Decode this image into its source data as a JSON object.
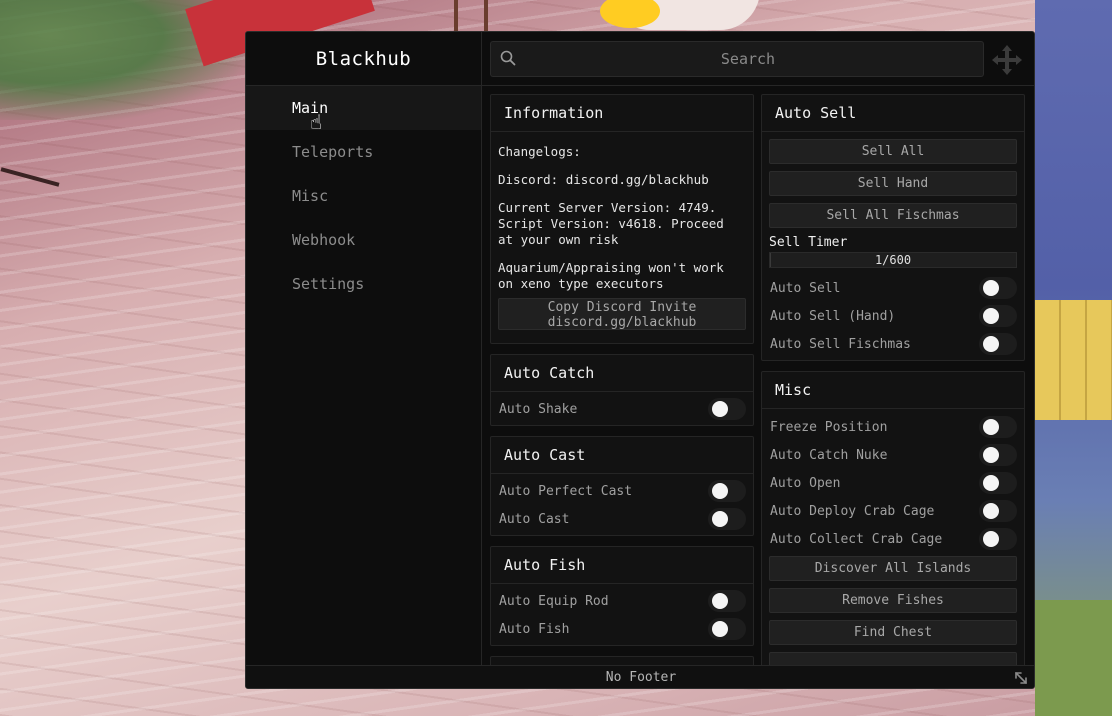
{
  "window": {
    "title": "Blackhub",
    "footer": "No Footer"
  },
  "sidebar": {
    "items": [
      {
        "label": "Main",
        "active": true
      },
      {
        "label": "Teleports"
      },
      {
        "label": "Misc"
      },
      {
        "label": "Webhook"
      },
      {
        "label": "Settings"
      }
    ]
  },
  "search": {
    "placeholder": "Search",
    "value": ""
  },
  "information": {
    "title": "Information",
    "changelogs": "Changelogs:",
    "discord": "Discord: discord.gg/blackhub",
    "version": "Current Server Version: 4749. Script Version: v4618. Proceed at your own risk",
    "warning": "Aquarium/Appraising won't work on xeno type executors",
    "copy_button_line1": "Copy Discord Invite",
    "copy_button_line2": "discord.gg/blackhub"
  },
  "auto_catch": {
    "title": "Auto Catch",
    "toggles": [
      "Auto Shake"
    ]
  },
  "auto_cast": {
    "title": "Auto Cast",
    "toggles": [
      "Auto Perfect Cast",
      "Auto Cast"
    ]
  },
  "auto_fish": {
    "title": "Auto Fish",
    "toggles": [
      "Auto Equip Rod",
      "Auto Fish"
    ]
  },
  "auto_sell": {
    "title": "Auto Sell",
    "buttons": [
      "Sell All",
      "Sell Hand",
      "Sell All Fischmas"
    ],
    "sell_timer": {
      "label": "Sell Timer",
      "value": 1,
      "max": 600,
      "display": "1/600"
    },
    "toggles": [
      "Auto Sell",
      "Auto Sell (Hand)",
      "Auto Sell Fischmas"
    ]
  },
  "misc": {
    "title": "Misc",
    "toggles": [
      "Freeze Position",
      "Auto Catch Nuke",
      "Auto Open",
      "Auto Deploy Crab Cage",
      "Auto Collect Crab Cage"
    ],
    "buttons": [
      "Discover All Islands",
      "Remove Fishes",
      "Find Chest"
    ]
  },
  "colors": {
    "window_bg": "#0d0d0d",
    "panel_bg": "#121212",
    "text": "#cfcfcf",
    "toggle_knob": "#f5f5f5"
  }
}
